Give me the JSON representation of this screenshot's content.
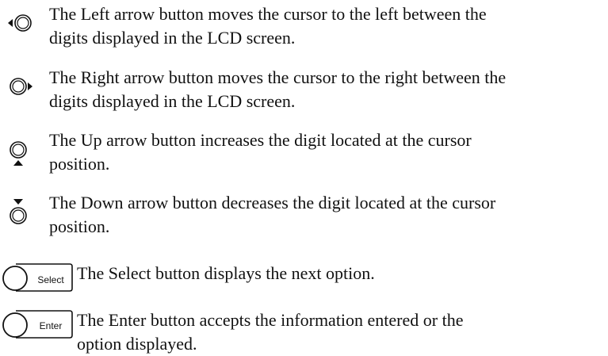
{
  "items": [
    {
      "icon": "left-arrow-button-icon",
      "text": "The Left arrow button moves the cursor to the left between the\ndigits displayed in the LCD screen."
    },
    {
      "icon": "right-arrow-button-icon",
      "text": "The Right arrow button moves the cursor to the right between the\ndigits displayed in the LCD screen."
    },
    {
      "icon": "up-arrow-button-icon",
      "text": "The Up arrow button increases the digit located at the cursor\nposition."
    },
    {
      "icon": "down-arrow-button-icon",
      "text": "The Down arrow button decreases the digit located at the cursor\nposition."
    },
    {
      "icon": "select-button-icon",
      "label": "Select",
      "text": "The Select button displays the next option."
    },
    {
      "icon": "enter-button-icon",
      "label": "Enter",
      "text": "The Enter button accepts the information entered or the\noption displayed."
    }
  ]
}
